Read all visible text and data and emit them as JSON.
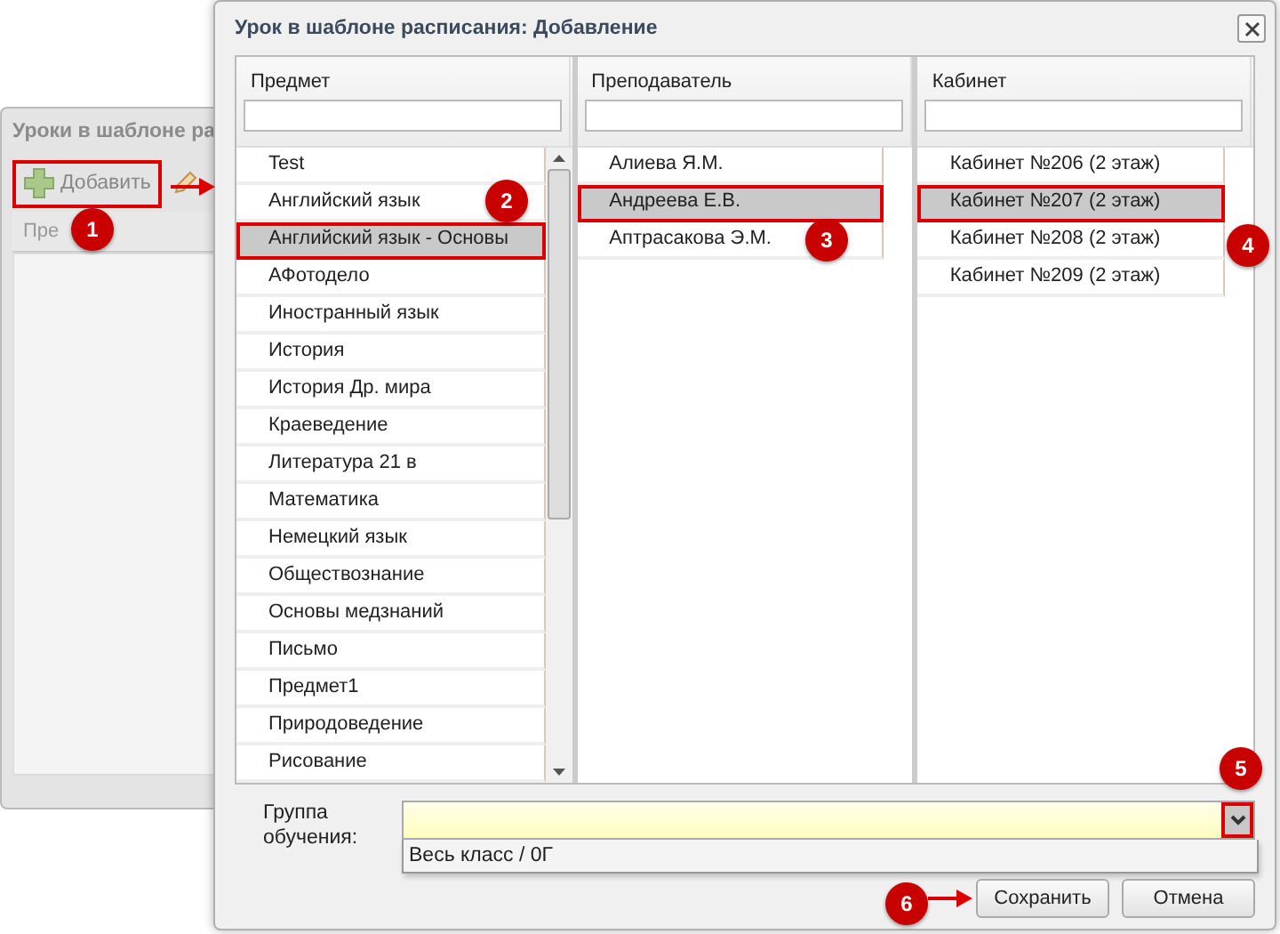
{
  "background_window": {
    "title": "Уроки в шаблоне ра",
    "add_button": {
      "label": "Добавить",
      "outlined": true
    },
    "column_header": "Пре"
  },
  "dialog": {
    "title": "Урок в шаблоне расписания: Добавление",
    "columns": [
      {
        "title": "Предмет",
        "scrollable": true,
        "items": [
          {
            "label": "Test",
            "selected": false
          },
          {
            "label": "Английский язык",
            "selected": false
          },
          {
            "label": "Английский язык - Основы",
            "selected": true
          },
          {
            "label": "АФотодело",
            "selected": false
          },
          {
            "label": "Иностранный язык",
            "selected": false
          },
          {
            "label": "История",
            "selected": false
          },
          {
            "label": "История Др. мира",
            "selected": false
          },
          {
            "label": "Краеведение",
            "selected": false
          },
          {
            "label": "Литература 21 в",
            "selected": false
          },
          {
            "label": "Математика",
            "selected": false
          },
          {
            "label": "Немецкий язык",
            "selected": false
          },
          {
            "label": "Обществознание",
            "selected": false
          },
          {
            "label": "Основы медзнаний",
            "selected": false
          },
          {
            "label": "Письмо",
            "selected": false
          },
          {
            "label": "Предмет1",
            "selected": false
          },
          {
            "label": "Природоведение",
            "selected": false
          },
          {
            "label": "Рисование",
            "selected": false
          }
        ]
      },
      {
        "title": "Преподаватель",
        "scrollable": false,
        "items": [
          {
            "label": "Алиева Я.М.",
            "selected": false
          },
          {
            "label": "Андреева Е.В.",
            "selected": true
          },
          {
            "label": "Аптрасакова Э.М.",
            "selected": false
          }
        ]
      },
      {
        "title": "Кабинет",
        "scrollable": false,
        "items": [
          {
            "label": "Кабинет №206 (2 этаж)",
            "selected": false
          },
          {
            "label": "Кабинет №207 (2 этаж)",
            "selected": true
          },
          {
            "label": "Кабинет №208 (2 этаж)",
            "selected": false
          },
          {
            "label": "Кабинет №209 (2 этаж)",
            "selected": false
          }
        ]
      }
    ],
    "group_field": {
      "label": "Группа обучения:",
      "expanded": true,
      "options": [
        {
          "label": "Весь класс / 0Г"
        }
      ]
    },
    "buttons": [
      {
        "label": "Сохранить"
      },
      {
        "label": "Отмена"
      }
    ]
  },
  "callouts": [
    "1",
    "2",
    "3",
    "4",
    "5",
    "6"
  ]
}
